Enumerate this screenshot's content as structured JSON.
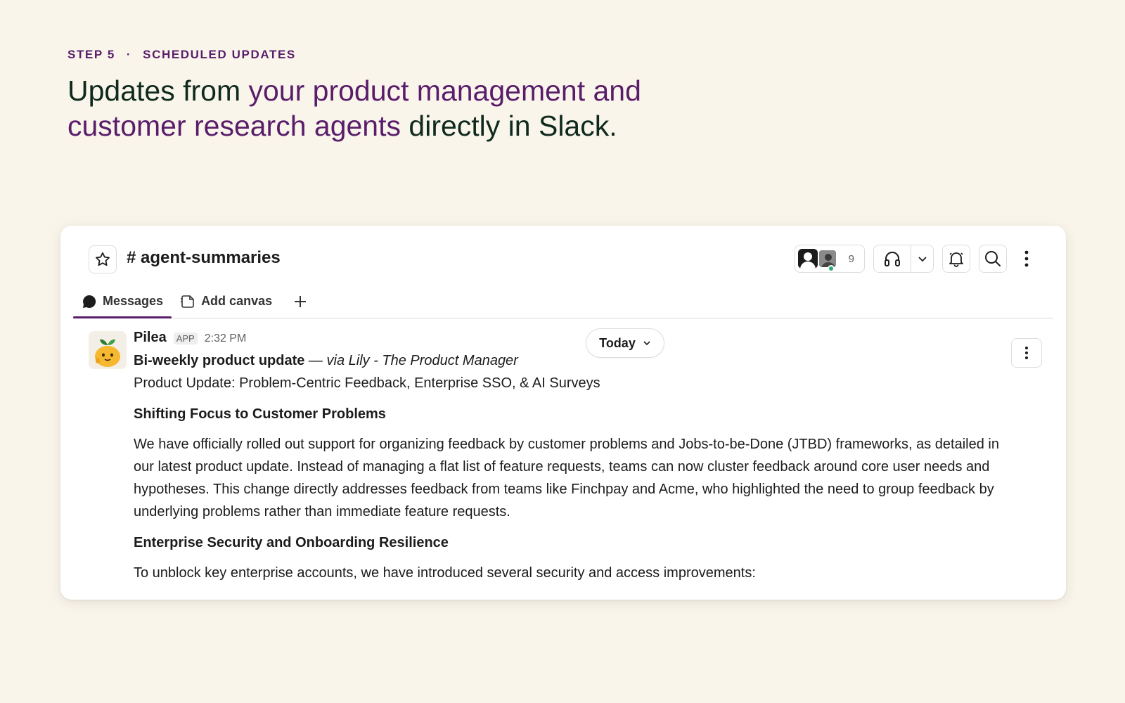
{
  "intro": {
    "step_label": "STEP 5",
    "separator": "·",
    "section_label": "SCHEDULED UPDATES",
    "headline_part1": "Updates from ",
    "headline_accent": "your product management and customer research agents",
    "headline_part2": " directly in Slack."
  },
  "channel": {
    "name": "# agent-summaries",
    "member_count": "9"
  },
  "tabs": [
    {
      "label": "Messages",
      "icon": "message-bubble-icon",
      "active": true
    },
    {
      "label": "Add canvas",
      "icon": "canvas-icon",
      "active": false
    }
  ],
  "divider": {
    "label": "Today"
  },
  "message": {
    "sender": "Pilea",
    "badge": "APP",
    "time": "2:32 PM",
    "title": "Bi-weekly product update",
    "via_sep": " — ",
    "via": "via Lily - The Product Manager",
    "subtitle": "Product Update: Problem-Centric Feedback, Enterprise SSO, & AI Surveys",
    "section1_heading": "Shifting Focus to Customer Problems",
    "section1_body": "We have officially rolled out support for organizing feedback by customer problems and Jobs-to-be-Done (JTBD) frameworks, as detailed in our latest product update. Instead of managing a flat list of feature requests, teams can now cluster feedback around core user needs and hypotheses. This change directly addresses feedback from teams like Finchpay and Acme, who highlighted the need to group feedback by underlying problems rather than immediate feature requests.",
    "section2_heading": "Enterprise Security and Onboarding Resilience",
    "section2_body": "To unblock key enterprise accounts, we have introduced several security and access improvements:"
  },
  "colors": {
    "background": "#f9f5eb",
    "accent": "#5a1d6a",
    "headline": "#0f2a1d",
    "online": "#2bac76"
  }
}
